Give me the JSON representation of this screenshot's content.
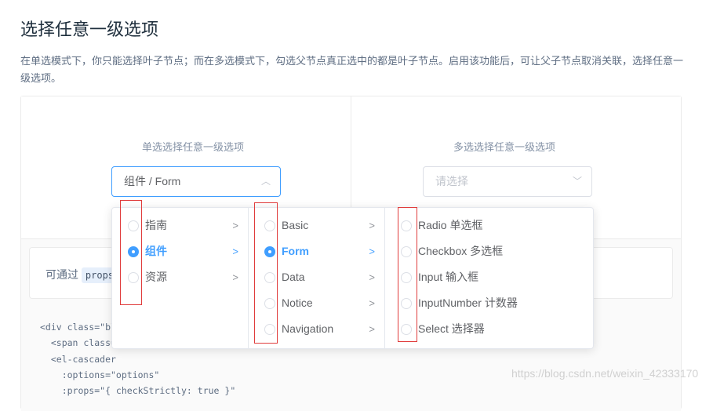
{
  "title": "选择任意一级选项",
  "description": "在单选模式下，你只能选择叶子节点；而在多选模式下，勾选父节点真正选中的都是叶子节点。启用该功能后，可让父子节点取消关联，选择任意一级选项。",
  "single": {
    "label": "单选选择任意一级选项",
    "value": "组件 / Form"
  },
  "multiple": {
    "label": "多选选择任意一级选项",
    "placeholder": "请选择"
  },
  "tip": {
    "prefix": "可通过",
    "code": "props"
  },
  "code_lines": [
    "<div class=\"bl",
    "  <span class=",
    "  <el-cascader",
    "    :options=\"options\"",
    "    :props=\"{ checkStrictly: true }\""
  ],
  "cascader": {
    "col1": [
      {
        "label": "指南"
      },
      {
        "label": "组件",
        "selected": true
      },
      {
        "label": "资源"
      }
    ],
    "col2": [
      {
        "label": "Basic"
      },
      {
        "label": "Form",
        "selected": true
      },
      {
        "label": "Data"
      },
      {
        "label": "Notice"
      },
      {
        "label": "Navigation"
      }
    ],
    "col3": [
      {
        "label": "Radio 单选框"
      },
      {
        "label": "Checkbox 多选框"
      },
      {
        "label": "Input 输入框"
      },
      {
        "label": "InputNumber 计数器"
      },
      {
        "label": "Select 选择器"
      }
    ]
  },
  "watermark": "https://blog.csdn.net/weixin_42333170",
  "colors": {
    "accent": "#409eff",
    "highlight": "#e03c3c"
  }
}
